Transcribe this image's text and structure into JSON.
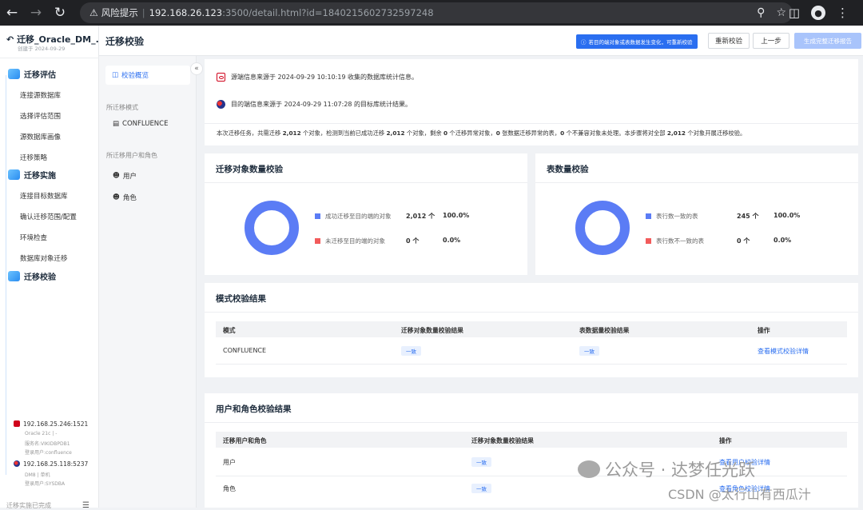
{
  "browser": {
    "warning_label": "风险提示",
    "url_host": "192.168.26.123",
    "url_rest": ":3500/detail.html?id=1840215602732597248"
  },
  "sidebar": {
    "task_title": "迁移_Oracle_DM_...",
    "created": "创建于 2024-09-29",
    "stages": [
      {
        "label": "迁移评估",
        "items": [
          "连接源数据库",
          "选择评估范围",
          "源数据库画像",
          "迁移策略"
        ]
      },
      {
        "label": "迁移实施",
        "items": [
          "连接目标数据库",
          "确认迁移范围/配置",
          "环境检查",
          "数据库对象迁移"
        ]
      },
      {
        "label": "迁移校验",
        "items": []
      }
    ],
    "connections": [
      {
        "host": "192.168.25.246:1521",
        "lines": [
          "Oracle 21c | -",
          "服务名:VIKIDBPDB1",
          "登录用户:confluence"
        ]
      },
      {
        "host": "192.168.25.118:5237",
        "lines": [
          "DM8 | 单机",
          "登录用户:SYSDBA"
        ]
      }
    ],
    "footer": "迁移实施已完成"
  },
  "topbar": {
    "title": "迁移校验",
    "tip": "若目的端对象或表数据发生变化，可重新校验",
    "recheck": "重新校验",
    "prev": "上一步",
    "generate": "生成完整迁移报告"
  },
  "subnav": {
    "active": "校验概览",
    "mode_header": "所迁移模式",
    "mode": "CONFLUENCE",
    "users_header": "所迁移用户和角色",
    "user": "用户",
    "role": "角色"
  },
  "info": {
    "source_line": "源端信息来源于 2024-09-29 10:10:19 收集的数据库统计信息。",
    "target_line": "目的端信息来源于 2024-09-29 11:07:28 的目标库统计结果。",
    "summary": {
      "p1": "本次迁移任务，共需迁移 ",
      "total": "2,012",
      "p2": " 个对象，检测到当前已成功迁移 ",
      "success": "2,012",
      "p3": " 个对象，剩余 ",
      "remain": "0",
      "p4": " 个迁移异常对象，",
      "abnormal_tables": "0",
      "p5": " 张数据迁移异常的表，",
      "incompatible": "0",
      "p6": " 个不兼容对象未处理。本步骤将对全部 ",
      "all": "2,012",
      "p7": " 个对象开展迁移校验。"
    }
  },
  "object_card": {
    "title": "迁移对象数量校验",
    "legend": [
      {
        "label": "成功迁移至目的端的对象",
        "count": "2,012 个",
        "pct": "100.0%",
        "color": "#5b7cf5"
      },
      {
        "label": "未迁移至目的端的对象",
        "count": "0 个",
        "pct": "0.0%",
        "color": "#f25b5b"
      }
    ]
  },
  "table_card": {
    "title": "表数量校验",
    "legend": [
      {
        "label": "表行数一致的表",
        "count": "245 个",
        "pct": "100.0%",
        "color": "#5b7cf5"
      },
      {
        "label": "表行数不一致的表",
        "count": "0 个",
        "pct": "0.0%",
        "color": "#f25b5b"
      }
    ]
  },
  "schema_card": {
    "title": "模式校验结果",
    "headers": [
      "模式",
      "迁移对象数量校验结果",
      "表数据量校验结果",
      "操作"
    ],
    "row": {
      "name": "CONFLUENCE",
      "obj": "一致",
      "data": "一致",
      "action": "查看模式校验详情"
    }
  },
  "user_card": {
    "title": "用户和角色校验结果",
    "headers": [
      "迁移用户和角色",
      "迁移对象数量校验结果",
      "操作"
    ],
    "rows": [
      {
        "name": "用户",
        "result": "一致",
        "action": "查看用户校验详情"
      },
      {
        "name": "角色",
        "result": "一致",
        "action": "查看角色校验详情"
      }
    ]
  },
  "watermark": {
    "line1": "公众号 · 达梦任光跃",
    "line2": "CSDN @太行山有西瓜汁"
  },
  "colors": {
    "accent": "#2a6ef0",
    "donut": "#5b7cf5",
    "red": "#f25b5b"
  }
}
